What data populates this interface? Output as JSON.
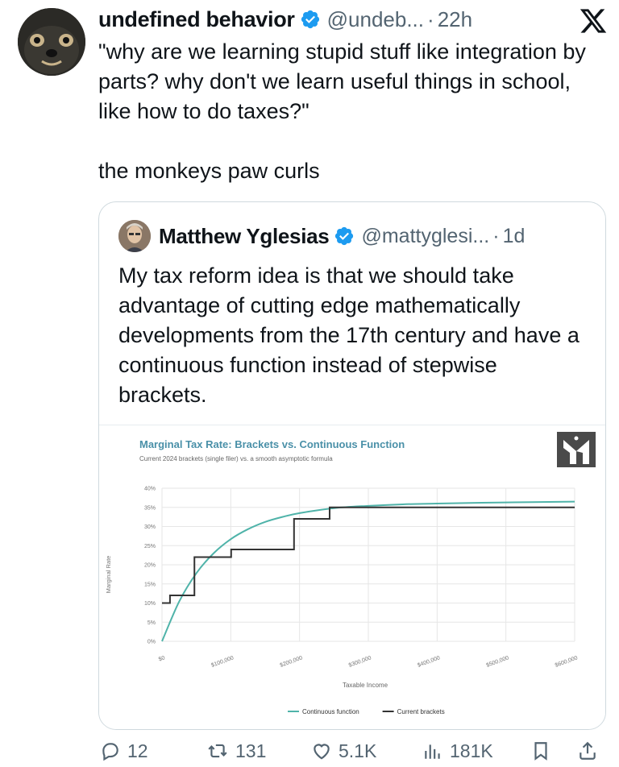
{
  "tweet": {
    "author_name": "undefined behavior",
    "handle": "@undeb...",
    "separator": "·",
    "time": "22h",
    "text": "\"why are we learning stupid stuff like integration by parts? why don't we learn useful things in school, like how to do taxes?\"\n\nthe monkeys paw curls"
  },
  "quote": {
    "author_name": "Matthew Yglesias",
    "handle": "@mattyglesi...",
    "separator": "·",
    "time": "1d",
    "text": "My tax reform idea is that we should take advantage of cutting edge mathematically developments from the 17th century and have a continuous function instead of stepwise brackets."
  },
  "chart_data": {
    "type": "line",
    "title": "Marginal Tax Rate: Brackets vs. Continuous Function",
    "subtitle": "Current 2024 brackets (single filer) vs. a smooth asymptotic formula",
    "xlabel": "Taxable Income",
    "ylabel": "Marginal Rate",
    "x_ticks": [
      "$0",
      "$100,000",
      "$200,000",
      "$300,000",
      "$400,000",
      "$500,000",
      "$600,000"
    ],
    "y_ticks": [
      "0%",
      "5%",
      "10%",
      "15%",
      "20%",
      "25%",
      "30%",
      "35%",
      "40%"
    ],
    "xlim": [
      0,
      600000
    ],
    "ylim": [
      0,
      40
    ],
    "grid": true,
    "legend_position": "bottom",
    "series": [
      {
        "name": "Continuous function",
        "color": "#4fb3a9",
        "x": [
          0,
          25000,
          50000,
          75000,
          100000,
          125000,
          150000,
          175000,
          200000,
          250000,
          300000,
          350000,
          400000,
          500000,
          600000
        ],
        "y": [
          0,
          10.4,
          17.8,
          23.0,
          26.7,
          29.3,
          31.2,
          32.5,
          33.5,
          34.8,
          35.4,
          35.8,
          36.0,
          36.3,
          36.5
        ]
      },
      {
        "name": "Current brackets",
        "color": "#333333",
        "x": [
          0,
          11600,
          11600,
          47150,
          47150,
          100525,
          100525,
          191950,
          191950,
          243725,
          243725,
          609350
        ],
        "y": [
          10,
          10,
          12,
          12,
          22,
          22,
          24,
          24,
          32,
          32,
          35,
          35
        ]
      }
    ]
  },
  "actions": {
    "replies": "12",
    "reposts": "131",
    "likes": "5.1K",
    "views": "181K"
  }
}
